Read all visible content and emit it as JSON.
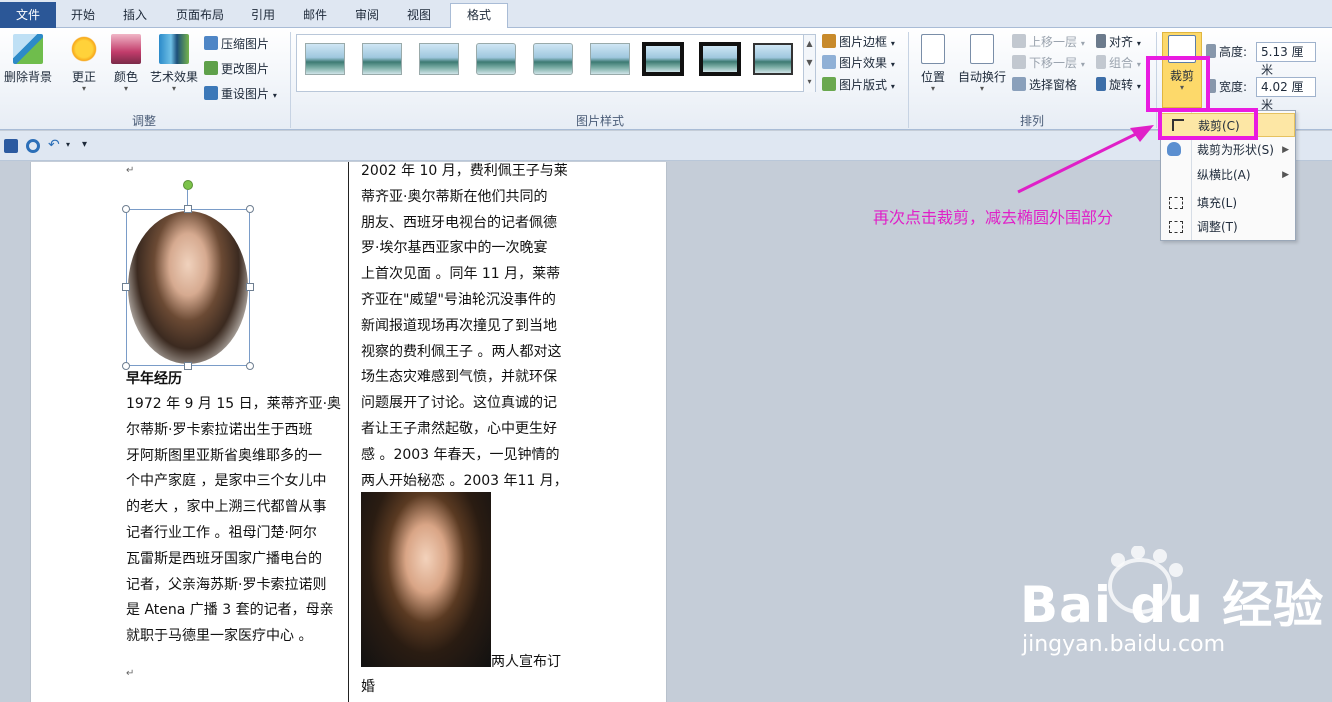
{
  "tabs": {
    "file": "文件",
    "home": "开始",
    "insert": "插入",
    "layout": "页面布局",
    "references": "引用",
    "mailings": "邮件",
    "review": "审阅",
    "view": "视图",
    "format": "格式"
  },
  "ribbon": {
    "adjust": {
      "remove_bg": "删除背景",
      "corrections": "更正",
      "color": "颜色",
      "artistic": "艺术效果",
      "compress": "压缩图片",
      "change": "更改图片",
      "reset": "重设图片",
      "label": "调整"
    },
    "styles": {
      "border": "图片边框",
      "effects": "图片效果",
      "layout": "图片版式",
      "label": "图片样式"
    },
    "arrange": {
      "position": "位置",
      "wrap": "自动换行",
      "forward": "上移一层",
      "backward": "下移一层",
      "selection": "选择窗格",
      "align": "对齐",
      "group": "组合",
      "rotate": "旋转",
      "label": "排列"
    },
    "size": {
      "crop": "裁剪",
      "height_label": "高度:",
      "height_value": "5.13 厘米",
      "width_label": "宽度:",
      "width_value": "4.02 厘米"
    }
  },
  "crop_menu": {
    "crop": "裁剪(C)",
    "crop_to_shape": "裁剪为形状(S)",
    "aspect_ratio": "纵横比(A)",
    "fill": "填充(L)",
    "fit": "调整(T)"
  },
  "annotation": "再次点击裁剪，减去椭圆外围部分",
  "document": {
    "col1_title": "早年经历",
    "col1_lines": [
      "1972 年 9 月 15 日，莱蒂齐亚·奥",
      "尔蒂斯·罗卡索拉诺出生于西班",
      "牙阿斯图里亚斯省奥维耶多的一",
      "个中产家庭 ，是家中三个女儿中",
      "的老大 ，家中上溯三代都曾从事",
      "记者行业工作 。祖母门楚·阿尔",
      "瓦雷斯是西班牙国家广播电台的",
      "记者，父亲海苏斯·罗卡索拉诺则",
      "是 Atena 广播 3 套的记者，母亲",
      "就职于马德里一家医疗中心 。"
    ],
    "col2_lines": [
      "2002 年 10 月，费利佩王子与莱",
      "蒂齐亚·奥尔蒂斯在他们共同的",
      "朋友、西班牙电视台的记者佩德",
      "罗·埃尔基西亚家中的一次晚宴",
      "上首次见面 。同年 11 月，莱蒂",
      "齐亚在\"威望\"号油轮沉没事件的",
      "新闻报道现场再次撞见了到当地",
      "视察的费利佩王子 。两人都对这",
      "场生态灾难感到气愤，并就环保",
      "问题展开了讨论。这位真诚的记",
      "者让王子肃然起敬，心中更生好",
      "感 。2003 年春天，一见钟情的",
      "两人开始秘恋 。2003 年11 月，"
    ],
    "tail_text": "两人宣布订",
    "tail_text_2": "婚"
  },
  "watermark": {
    "brand": "Bai du 经验",
    "url": "jingyan.baidu.com"
  },
  "colors": {
    "highlight": "#e91be0",
    "file_tab": "#2b5797",
    "menu_hover": "#fde7a5"
  }
}
